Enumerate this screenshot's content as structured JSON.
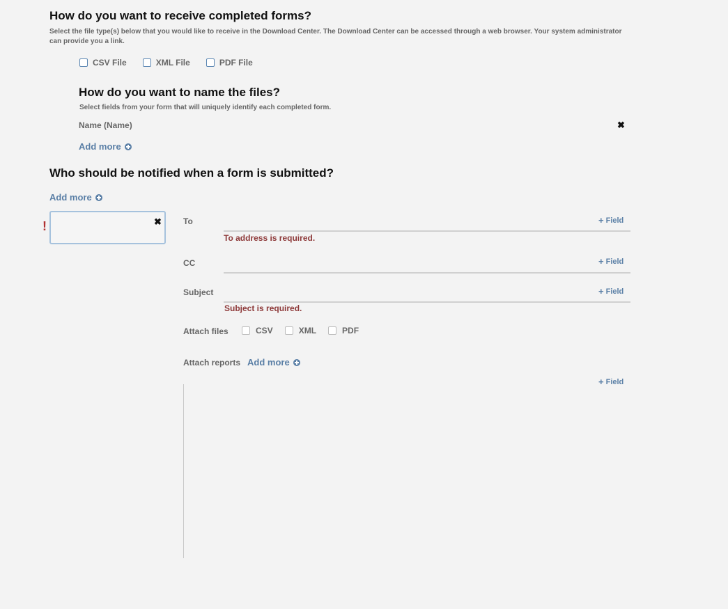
{
  "receive": {
    "title": "How do you want to receive completed forms?",
    "description": "Select the file type(s) below that you would like to receive in the Download Center. The Download Center can be accessed through a web browser. Your system administrator can provide you a link.",
    "options": [
      "CSV File",
      "XML File",
      "PDF File"
    ]
  },
  "naming": {
    "title": "How do you want to name the files?",
    "description": "Select fields from your form that will uniquely identify each completed form.",
    "field": "Name (Name)",
    "remove_icon": "✖",
    "add_more": "Add more"
  },
  "notify": {
    "title": "Who should be notified when a form is submitted?",
    "add_more": "Add more",
    "warning": "!",
    "remove_icon": "✖",
    "to_label": "To",
    "to_error": "To address is required.",
    "cc_label": "CC",
    "subject_label": "Subject",
    "subject_error": "Subject is required.",
    "field_button": "Field",
    "field_plus": "+",
    "attach_files_label": "Attach files",
    "attach_files_options": [
      "CSV",
      "XML",
      "PDF"
    ],
    "attach_reports_label": "Attach reports",
    "attach_reports_add": "Add more"
  },
  "colors": {
    "accent": "#5a7fa6",
    "error": "#8e3a3a",
    "background": "#f3f3f3"
  }
}
